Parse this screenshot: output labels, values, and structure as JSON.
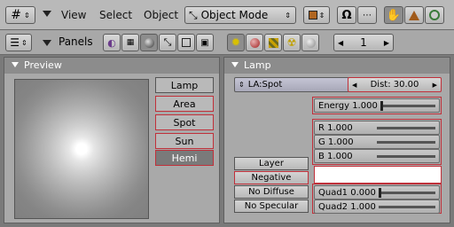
{
  "header": {
    "menus": [
      "View",
      "Select",
      "Object"
    ],
    "mode": "Object Mode"
  },
  "panels_header": {
    "label": "Panels",
    "frame": "1"
  },
  "preview": {
    "title": "Preview",
    "types": [
      "Lamp",
      "Area",
      "Spot",
      "Sun",
      "Hemi"
    ],
    "selected": "Hemi"
  },
  "lamp": {
    "title": "Lamp",
    "name": "LA:Spot",
    "dist": "Dist: 30.00",
    "energy": "Energy 1.000",
    "energy_value": 0.05,
    "r": "R 1.000",
    "r_value": 1.0,
    "g": "G 1.000",
    "g_value": 1.0,
    "b": "B 1.000",
    "b_value": 1.0,
    "buttons": [
      "Layer",
      "Negative",
      "No Diffuse",
      "No Specular"
    ],
    "quad1": "Quad1 0.000",
    "quad1_value": 0.0,
    "quad2": "Quad2 1.000",
    "quad2_value": 1.0
  }
}
